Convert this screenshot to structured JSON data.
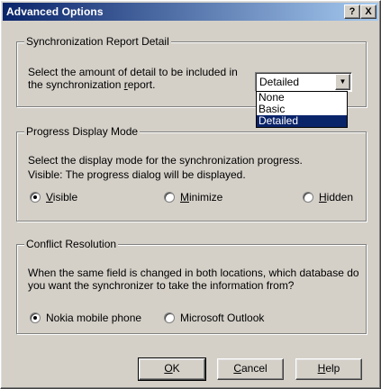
{
  "window": {
    "title": "Advanced Options",
    "help_btn": "?",
    "close_btn": "X"
  },
  "sync_report": {
    "legend": "Synchronization Report Detail",
    "desc_line1": "Select the amount of detail to be included in",
    "desc_line2": "the synchronization report.",
    "combo_value": "Detailed",
    "options": [
      "None",
      "Basic",
      "Detailed"
    ],
    "selected_index": 2
  },
  "progress": {
    "legend": "Progress Display Mode",
    "desc_line1": "Select the display mode for the synchronization progress.",
    "desc_line2": "Visible: The progress dialog will be displayed.",
    "options": [
      {
        "label": "Visible",
        "selected": true
      },
      {
        "label": "Minimize",
        "selected": false
      },
      {
        "label": "Hidden",
        "selected": false
      }
    ]
  },
  "conflict": {
    "legend": "Conflict Resolution",
    "desc_line1": "When the same field is changed in both locations, which database do",
    "desc_line2": "you want the synchronizer to take the information from?",
    "options": [
      {
        "label": "Nokia mobile phone",
        "selected": true
      },
      {
        "label": "Microsoft Outlook",
        "selected": false
      }
    ]
  },
  "buttons": {
    "ok": "OK",
    "cancel": "Cancel",
    "help": "Help"
  }
}
